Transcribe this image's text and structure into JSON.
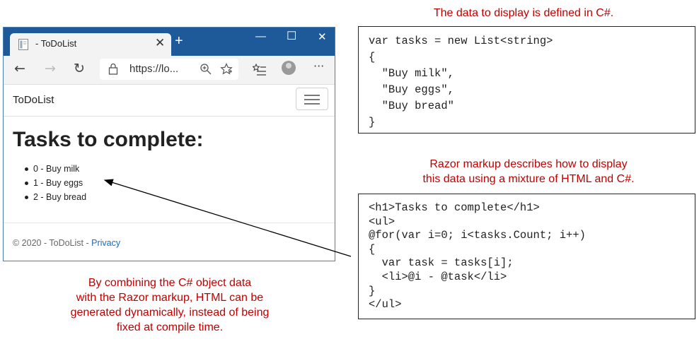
{
  "annotations": {
    "top_right": "The data to display is defined in C#.",
    "middle_right_line1": "Razor markup describes how to display",
    "middle_right_line2": "this data using a mixture of HTML and C#.",
    "bottom_left_line1": "By combining the C# object data",
    "bottom_left_line2": "with the Razor markup, HTML can be",
    "bottom_left_line3": "generated dynamically, instead of being",
    "bottom_left_line4": "fixed at compile time."
  },
  "csharp_code": [
    "var tasks = new List<string>",
    "{",
    "  \"Buy milk\",",
    "  \"Buy eggs\",",
    "  \"Buy bread\"",
    "}"
  ],
  "razor_code": [
    "<h1>Tasks to complete</h1>",
    "<ul>",
    "@for(var i=0; i<tasks.Count; i++)",
    "{",
    "  var task = tasks[i];",
    "  <li>@i - @task</li>",
    "}",
    "</ul>"
  ],
  "browser": {
    "tab_title": "- ToDoList",
    "tab_close": "✕",
    "new_tab": "+",
    "minimize": "—",
    "maximize": "☐",
    "close": "✕",
    "back": "←",
    "forward": "→",
    "refresh": "↻",
    "address": "https://lo...",
    "more": "···",
    "icons": [
      "page-icon",
      "back-arrow-icon",
      "forward-arrow-icon",
      "refresh-icon",
      "lock-icon",
      "zoom-icon",
      "favorite-star-icon",
      "favorites-list-icon",
      "profile-avatar-icon",
      "more-icon"
    ]
  },
  "page": {
    "brand": "ToDoList",
    "heading": "Tasks to complete:",
    "tasks": [
      "0 - Buy milk",
      "1 - Buy eggs",
      "2 - Buy bread"
    ],
    "footer_text": "© 2020 - ToDoList - ",
    "footer_link": "Privacy"
  },
  "colors": {
    "annotation": "#c00000",
    "titlebar": "#1e5a99",
    "link": "#1a6bb8"
  }
}
